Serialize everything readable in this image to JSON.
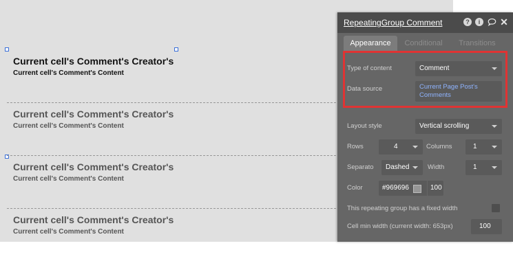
{
  "repeating_group": {
    "cells": [
      {
        "creator": "Current cell's Comment's Creator's",
        "content": "Current cell's Comment's Content"
      },
      {
        "creator": "Current cell's Comment's Creator's",
        "content": "Current cell's Comment's Content"
      },
      {
        "creator": "Current cell's Comment's Creator's",
        "content": "Current cell's Comment's Content"
      },
      {
        "creator": "Current cell's Comment's Creator's",
        "content": "Current cell's Comment's Content"
      }
    ]
  },
  "panel": {
    "title": "RepeatingGroup Comment",
    "header_icons": [
      "help-icon",
      "info-icon",
      "comment-icon",
      "close-icon"
    ],
    "tabs": [
      {
        "label": "Appearance",
        "active": true
      },
      {
        "label": "Conditional",
        "active": false
      },
      {
        "label": "Transitions",
        "active": false
      }
    ],
    "type_of_content": {
      "label": "Type of content",
      "value": "Comment"
    },
    "data_source": {
      "label": "Data source",
      "value": "Current Page Post's Comments"
    },
    "layout_style": {
      "label": "Layout style",
      "value": "Vertical scrolling"
    },
    "rows": {
      "label": "Rows",
      "value": "4"
    },
    "columns": {
      "label": "Columns",
      "value": "1"
    },
    "separator": {
      "label": "Separato",
      "value": "Dashed"
    },
    "width": {
      "label": "Width",
      "value": "1"
    },
    "color": {
      "label": "Color",
      "value": "#969696",
      "opacity": "100",
      "swatch": "#969696"
    },
    "fixed_width": {
      "label": "This repeating group has a fixed width",
      "checked": false
    },
    "cell_min_width": {
      "label": "Cell min width (current width: 653px)",
      "value": "100"
    }
  },
  "colors": {
    "highlight": "#e03333",
    "link": "#8fb4ff",
    "panel_bg": "#666666",
    "canvas_bg": "#e0e0e0"
  }
}
